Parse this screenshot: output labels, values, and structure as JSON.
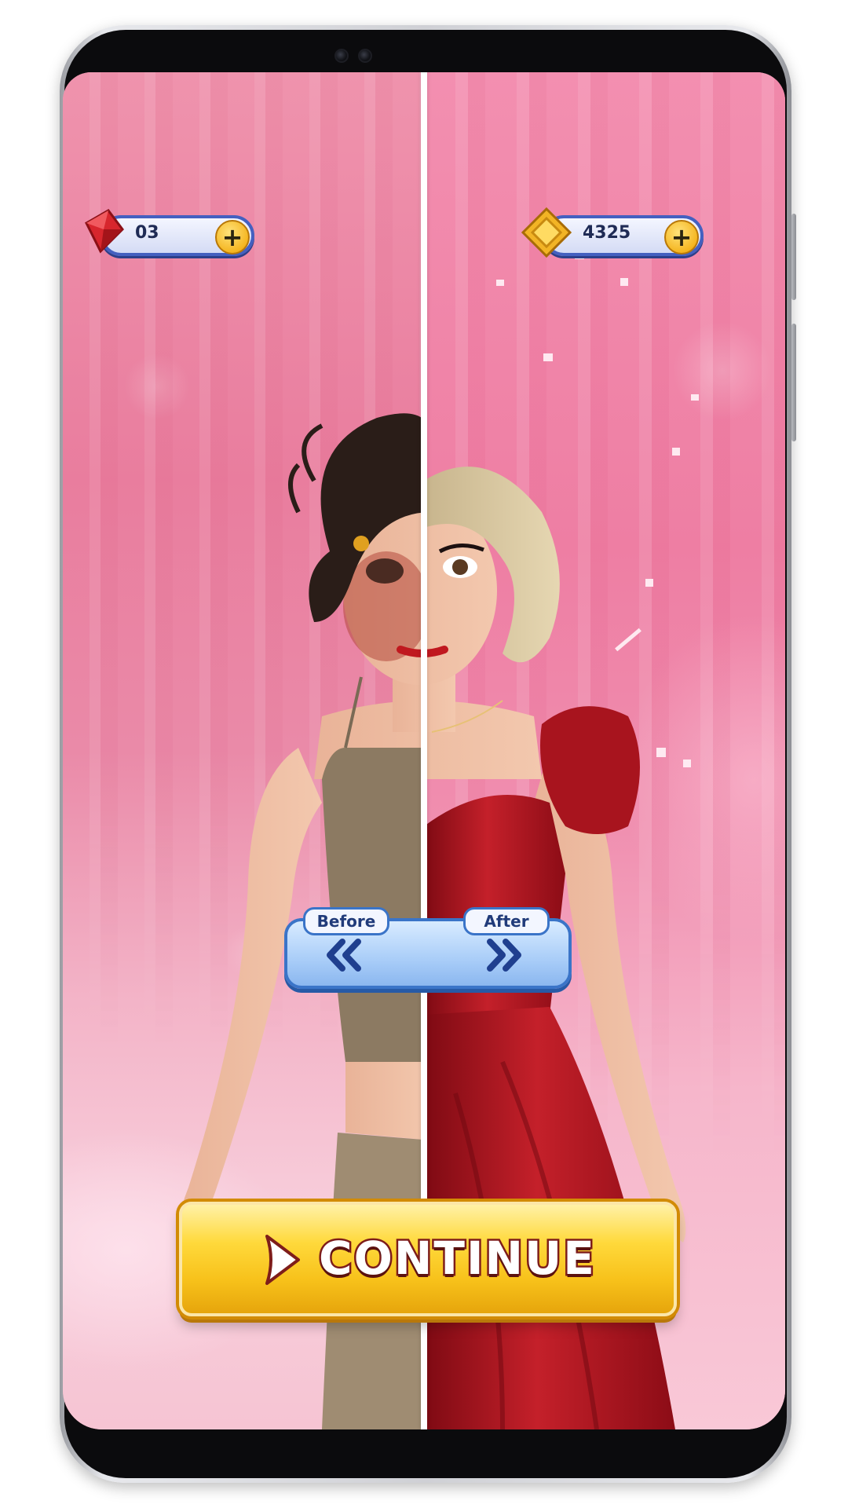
{
  "game": {
    "currencies": {
      "gems": {
        "icon": "red-gem-icon",
        "value": "03",
        "plus": "+"
      },
      "coins": {
        "icon": "gold-coin-icon",
        "value": "4325",
        "plus": "+"
      }
    },
    "compare": {
      "before_label": "Before",
      "after_label": "After",
      "before_icon": "double-chevron-left-icon",
      "after_icon": "double-chevron-right-icon"
    },
    "continue_button": {
      "label": "CONTINUE",
      "icon": "play-arrow-icon"
    }
  },
  "colors": {
    "background_pink": "#ee7ea3",
    "divider": "#ffffff",
    "pill_border": "#4460c0",
    "toggle_border": "#3a74c8",
    "continue_yellow": "#f7c11a",
    "continue_text_outline": "#7e1d1a",
    "dress_red": "#a7121c"
  }
}
